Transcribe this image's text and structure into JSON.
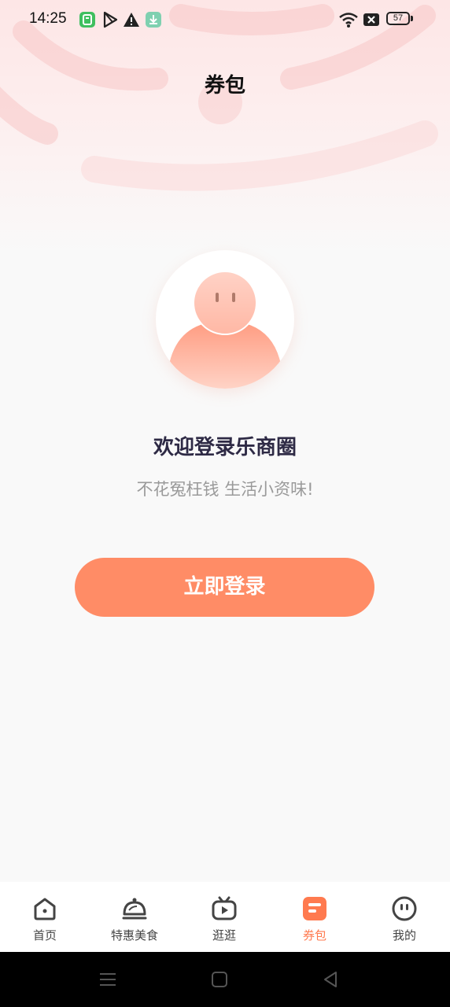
{
  "status_bar": {
    "time": "14:25",
    "battery": "57",
    "icons": [
      "app-notification-icon",
      "play-store-icon",
      "warning-icon",
      "download-icon",
      "wifi-icon",
      "sim-off-icon",
      "battery-icon"
    ]
  },
  "header": {
    "title": "券包"
  },
  "welcome": {
    "title": "欢迎登录乐商圈",
    "subtitle": "不花冤枉钱 生活小资味!"
  },
  "login": {
    "button_label": "立即登录"
  },
  "tabs": [
    {
      "label": "首页",
      "icon": "home-icon",
      "active": false
    },
    {
      "label": "特惠美食",
      "icon": "food-cloche-icon",
      "active": false
    },
    {
      "label": "逛逛",
      "icon": "video-tv-icon",
      "active": false
    },
    {
      "label": "券包",
      "icon": "coupon-icon",
      "active": true
    },
    {
      "label": "我的",
      "icon": "profile-face-icon",
      "active": false
    }
  ],
  "system_nav": {
    "icons": [
      "menu-icon",
      "home-square-icon",
      "back-triangle-icon"
    ]
  },
  "colors": {
    "accent": "#ff8c66",
    "active_tab": "#ff7a4f",
    "title_text": "#2e2a45",
    "subtitle_text": "#9a9a9a"
  }
}
